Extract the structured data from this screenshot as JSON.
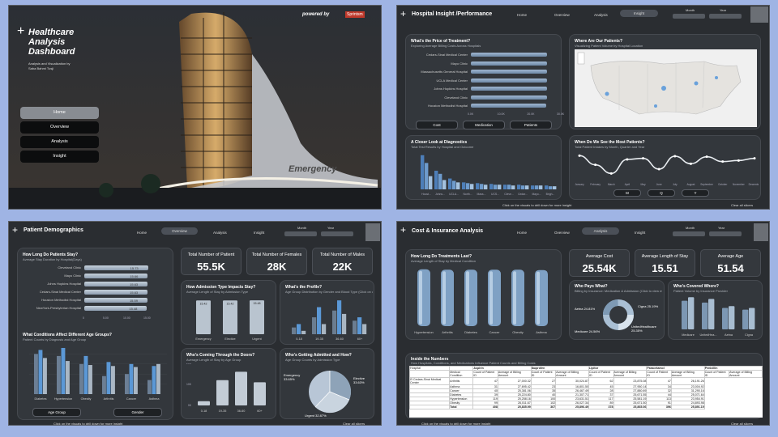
{
  "home": {
    "title_lines": [
      "Healthcare",
      "Analysis",
      "Dashboard"
    ],
    "subtitle": "Analysis and Visualization by",
    "author": "Saba Bahmi Tusji",
    "powered": "powered by",
    "brand": "Sprintsm",
    "emergency": "Emergency",
    "nav": [
      "Home",
      "Overview",
      "Analysis",
      "Insight"
    ]
  },
  "insight": {
    "title": "Hospital Insight /Performance",
    "nav": [
      "Home",
      "Overview",
      "Analysis",
      "Insight"
    ],
    "month_label": "Month",
    "year_label": "Year",
    "price": {
      "title": "What's the Price of Treatment?",
      "sub": "Exploring Average Billing Costs Across Hospitals",
      "hospitals": [
        "Cedars-Sinai Medical Center",
        "Mayo Clinic",
        "Massachusetts General Hospital",
        "UCLA Medical Center",
        "Johns Hopkins Hospital",
        "Cleveland Clinic",
        "Houston Methodist Hospital"
      ],
      "values": [
        25.7,
        25.6,
        25.6,
        25.6,
        25.5,
        25.5,
        25.4
      ],
      "axis": [
        "0.0K",
        "10.0K",
        "20.0K",
        "30.0K"
      ],
      "buttons": [
        "Cost",
        "Medication",
        "Patients"
      ]
    },
    "map": {
      "title": "Where Are Our Patients?",
      "sub": "Visualizing Patient Volume by Hospital Location"
    },
    "diag": {
      "title": "A Closer Look at Diagnostics",
      "sub": "Total Test Results by Hospital and Outcome",
      "cats": [
        "Houst...",
        "Johns...",
        "UCLA...",
        "North...",
        "Mass...",
        "UCS...",
        "Cleve...",
        "Cedar...",
        "Mayo...",
        "Brigh..."
      ],
      "s1": [
        44,
        24,
        14,
        9,
        8,
        7,
        6,
        6,
        5,
        5
      ],
      "s2": [
        34,
        20,
        11,
        8,
        7,
        6,
        6,
        5,
        5,
        4
      ],
      "s3": [
        17,
        12,
        9,
        7,
        6,
        6,
        5,
        5,
        5,
        4
      ]
    },
    "trend": {
      "title": "When Do We See the Most Patients?",
      "sub": "Total Patient Intakes by Month, Quarter and Year",
      "months": [
        "January",
        "February",
        "March",
        "April",
        "May",
        "June",
        "July",
        "August",
        "September",
        "October",
        "November",
        "December"
      ],
      "values": [
        55,
        38,
        22,
        48,
        50,
        30,
        54,
        40,
        53,
        44,
        46,
        50
      ],
      "buttons": [
        "M",
        "Q",
        "Y"
      ]
    },
    "footer": "Click on the visuals to drill down for more insight",
    "clear": "Clear all slicers"
  },
  "demo": {
    "title": "Patient Demographics",
    "nav": [
      "Home",
      "Overview",
      "Analysis",
      "Insight"
    ],
    "month_label": "Month",
    "year_label": "Year",
    "stay": {
      "title": "How Long Do Patients Stay?",
      "sub": "Average Stay Duration by Hospital(Days)",
      "hospitals": [
        "Cleveland Clinic",
        "Mayo Clinic",
        "Johns Hopkins Hospital",
        "Cedars-Sinai Medical Center",
        "Houston Methodist Hospital",
        "NewYork-Presbyterian Hospital"
      ],
      "values": [
        15.73,
        15.66,
        15.63,
        15.63,
        15.59,
        15.48
      ],
      "labels": [
        "15.73",
        "15.66",
        "15.63",
        "15.63",
        "15.59",
        "15.48"
      ],
      "axis": [
        "0",
        "5.00",
        "10.00",
        "15.00"
      ]
    },
    "kpis": [
      {
        "label": "Total Number of Patient",
        "value": "55.5K"
      },
      {
        "label": "Total Number of Females",
        "value": "28K"
      },
      {
        "label": "Total Number of Males",
        "value": "22K"
      }
    ],
    "cond": {
      "title": "What Conditions Affect Different Age Groups?",
      "sub": "Patient Counts by Diagnosis and Age Group",
      "cats": [
        "Diabetes",
        "Hypertension",
        "Obesity",
        "Arthritis",
        "Cancer",
        "Asthma"
      ],
      "s1": [
        40,
        38,
        30,
        18,
        20,
        14
      ],
      "s2": [
        44,
        46,
        38,
        32,
        30,
        28
      ],
      "s3": [
        36,
        33,
        29,
        28,
        27,
        30
      ]
    },
    "btns": [
      "Age Group",
      "Gender"
    ],
    "adm": {
      "title": "How Admission Type Impacts Stay?",
      "sub": "Average Length of Stay by Admission Type",
      "cats": [
        "Emergency",
        "Elective",
        "Urgent"
      ],
      "values": [
        15.42,
        15.42,
        15.48
      ],
      "labels": [
        "15.42",
        "15.42",
        "15.48"
      ]
    },
    "profile": {
      "title": "What's the Profile?",
      "sub": "Age Group Distribution by Gender and Blood Type (Click on one Blood type)",
      "cats": [
        "0-18",
        "19-35",
        "36-60",
        "60+"
      ],
      "s1": [
        2,
        5,
        7,
        4
      ],
      "s2": [
        3,
        8,
        10,
        5
      ],
      "s3": [
        1,
        3,
        6,
        3
      ]
    },
    "doors": {
      "title": "Who's Coming Through the Doors?",
      "sub": "Average Length of Stay by Age Group",
      "cats": [
        "0-18",
        "19-35",
        "36-60",
        "60+"
      ],
      "values": [
        2,
        12,
        16,
        11
      ],
      "axis": [
        "0K",
        "10K",
        "20K"
      ]
    },
    "admitted": {
      "title": "Who's Getting Admitted and How?",
      "sub": "Age Group Counts by Admission Type",
      "labels": [
        "Emergency 33.65%",
        "Elective 33.63%",
        "Urgent 32.87%"
      ]
    },
    "footer": "Click on the visuals to drill down for more insight",
    "clear": "Clear all slicers"
  },
  "cost": {
    "title": "Cost & Insurance Analysis",
    "nav": [
      "Home",
      "Overview",
      "Analysis",
      "Insight"
    ],
    "month_label": "Month",
    "year_label": "Year",
    "treat": {
      "title": "How Long Do Treatments Last?",
      "sub": "Average Length of Stay by Medical Condition",
      "cats": [
        "Hypertension",
        "Arthritis",
        "Diabetes",
        "Cancer",
        "Obesity",
        "Asthma"
      ],
      "values": [
        15.6,
        15.5,
        15.5,
        15.5,
        15.5,
        15.4
      ]
    },
    "kpis": [
      {
        "label": "Average Cost",
        "value": "25.54K"
      },
      {
        "label": "Average Length of Stay",
        "value": "15.51"
      },
      {
        "label": "Average Age",
        "value": "51.54"
      }
    ],
    "pays": {
      "title": "Who Pays What?",
      "sub": "Billing by Insurance: Medication & Admission (Click to view more)",
      "labels": [
        "Aetna 24.81%",
        "Cigna 25.19%",
        "Medicare 24.56%",
        "UnitedHealthcare 25.35%"
      ]
    },
    "covered": {
      "title": "Who's Covered Where?",
      "sub": "Patient Volume by Insurance Provider",
      "cats": [
        "Medicare",
        "UnitedHea...",
        "Aetna",
        "Cigna"
      ],
      "s1": [
        16,
        15,
        12,
        11
      ],
      "s2": [
        18,
        17,
        13,
        12
      ]
    },
    "table": {
      "title": "Inside the Numbers",
      "sub": "How Hospitals, Conditions, and Medications Influence Patient Counts and Billing Costs",
      "groups": [
        "Aspirin",
        "Ibuprofen",
        "Lipitor",
        "Paracetamol",
        "Penicillin"
      ],
      "h1": "Hospital",
      "h2": "Medical Condition",
      "h3": "Count of Patient ID",
      "h4": "Average of Billing Amount",
      "hospital": "Cedars-Sinai Medical Center",
      "rows": [
        [
          "Arthritis",
          "47",
          "27,000.32",
          "27",
          "30,024.87",
          "62",
          "23,875.08",
          "47",
          "26,191.26"
        ],
        [
          "Asthma",
          "31",
          "27,695.42",
          "23",
          "16,801.50",
          "45",
          "27,950.14",
          "34",
          "23,004.92"
        ],
        [
          "Cancer",
          "40",
          "25,381.06",
          "35",
          "26,467.49",
          "28",
          "27,880.69",
          "32",
          "31,290.16"
        ],
        [
          "Diabetes",
          "39",
          "25,224.80",
          "40",
          "21,307.71",
          "37",
          "25,671.55",
          "44",
          "25,071.64"
        ],
        [
          "Hypertension",
          "119",
          "25,258.16",
          "100",
          "23,631.51",
          "117",
          "25,581.19",
          "113",
          "23,954.91"
        ],
        [
          "Obesity",
          "99",
          "26,011.67",
          "102",
          "26,027.34",
          "89",
          "25,671.50",
          "91",
          "24,893.98"
        ],
        [
          "Total",
          "408",
          "25,835.99",
          "367",
          "25,896.49",
          "378",
          "25,865.06",
          "396",
          "25,891.19"
        ]
      ]
    },
    "footer": "Click on the visuals to drill down for more insight",
    "clear": "Clear all slicers"
  }
}
